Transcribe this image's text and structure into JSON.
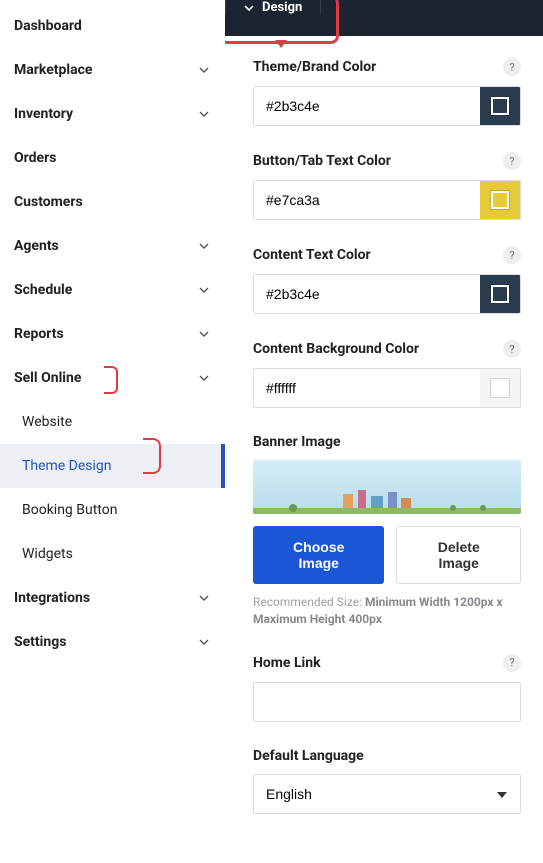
{
  "sidebar": {
    "items": [
      {
        "label": "Dashboard",
        "chevron": false
      },
      {
        "label": "Marketplace",
        "chevron": true
      },
      {
        "label": "Inventory",
        "chevron": true
      },
      {
        "label": "Orders",
        "chevron": false
      },
      {
        "label": "Customers",
        "chevron": false
      },
      {
        "label": "Agents",
        "chevron": true
      },
      {
        "label": "Schedule",
        "chevron": true
      },
      {
        "label": "Reports",
        "chevron": true
      },
      {
        "label": "Sell Online",
        "chevron": true
      }
    ],
    "sub": [
      {
        "label": "Website"
      },
      {
        "label": "Theme Design"
      },
      {
        "label": "Booking Button"
      },
      {
        "label": "Widgets"
      }
    ],
    "tail": [
      {
        "label": "Integrations",
        "chevron": true
      },
      {
        "label": "Settings",
        "chevron": true
      }
    ]
  },
  "top_tab": {
    "label": "Design"
  },
  "fields": {
    "theme_color": {
      "label": "Theme/Brand Color",
      "value": "#2b3c4e",
      "swatch": "#2b3c4e"
    },
    "button_text": {
      "label": "Button/Tab Text Color",
      "value": "#e7ca3a",
      "swatch": "#e7ca3a"
    },
    "content_text": {
      "label": "Content Text Color",
      "value": "#2b3c4e",
      "swatch": "#2b3c4e"
    },
    "content_bg": {
      "label": "Content Background Color",
      "value": "#ffffff",
      "swatch": "#ffffff"
    },
    "banner": {
      "label": "Banner Image",
      "choose": "Choose Image",
      "delete": "Delete Image",
      "reco_pre": "Recommended Size: ",
      "reco_bold": "Minimum Width 1200px x Maximum Height 400px"
    },
    "home_link": {
      "label": "Home Link",
      "value": ""
    },
    "lang": {
      "label": "Default Language",
      "value": "English"
    }
  }
}
